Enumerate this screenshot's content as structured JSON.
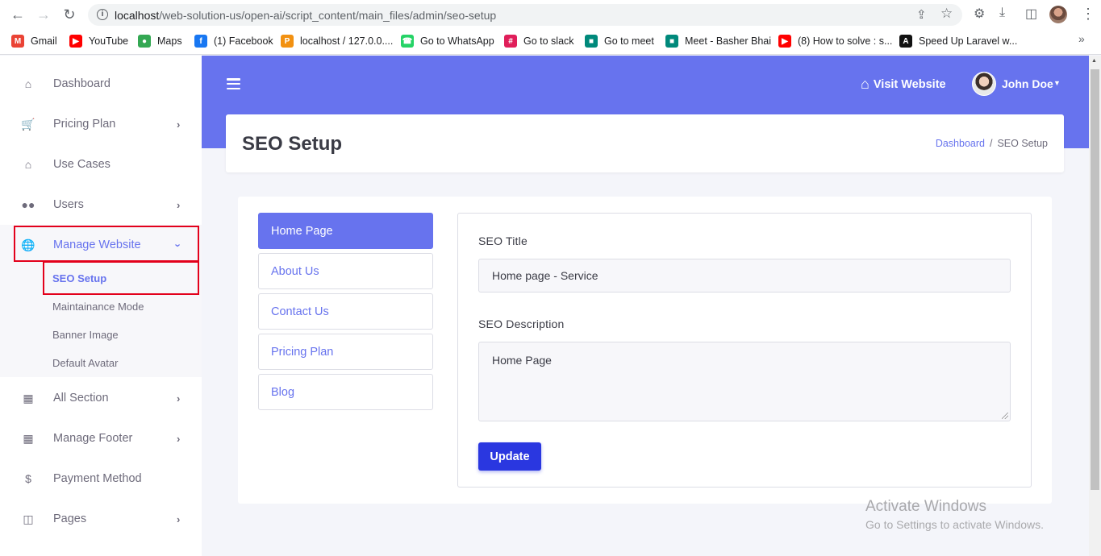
{
  "browser": {
    "url_host": "localhost",
    "url_path": "/web-solution-us/open-ai/script_content/main_files/admin/seo-setup",
    "bookmarks": [
      {
        "label": "Gmail",
        "icon": "gmail-icon",
        "color": "#ea4335"
      },
      {
        "label": "YouTube",
        "icon": "youtube-icon",
        "color": "#ff0000"
      },
      {
        "label": "Maps",
        "icon": "maps-icon",
        "color": "#34a853"
      },
      {
        "label": "(1) Facebook",
        "icon": "facebook-icon",
        "color": "#1877f2"
      },
      {
        "label": "localhost / 127.0.0....",
        "icon": "phpmyadmin-icon",
        "color": "#f29111"
      },
      {
        "label": "Go to WhatsApp",
        "icon": "whatsapp-icon",
        "color": "#25d366"
      },
      {
        "label": "Go to slack",
        "icon": "slack-icon",
        "color": "#e01e5a"
      },
      {
        "label": "Go to meet",
        "icon": "meet-icon",
        "color": "#00897b"
      },
      {
        "label": "Meet - Basher Bhai",
        "icon": "meet-icon",
        "color": "#00897b"
      },
      {
        "label": "(8) How to solve : s...",
        "icon": "youtube-icon",
        "color": "#ff0000"
      },
      {
        "label": "Speed Up Laravel w...",
        "icon": "laravel-icon",
        "color": "#111111"
      }
    ]
  },
  "sidebar": {
    "items": [
      {
        "label": "Dashboard",
        "icon": "home-icon",
        "has_children": false
      },
      {
        "label": "Pricing Plan",
        "icon": "cart-icon",
        "has_children": true
      },
      {
        "label": "Use Cases",
        "icon": "home-icon",
        "has_children": false
      },
      {
        "label": "Users",
        "icon": "users-icon",
        "has_children": true
      },
      {
        "label": "Manage Website",
        "icon": "globe-icon",
        "has_children": true,
        "expanded": true
      },
      {
        "label": "All Section",
        "icon": "grid-icon",
        "has_children": true
      },
      {
        "label": "Manage Footer",
        "icon": "grid-icon",
        "has_children": true
      },
      {
        "label": "Payment Method",
        "icon": "dollar-icon",
        "has_children": false
      },
      {
        "label": "Pages",
        "icon": "columns-icon",
        "has_children": true
      }
    ],
    "submenu": [
      "SEO Setup",
      "Maintainance Mode",
      "Banner Image",
      "Default Avatar"
    ],
    "active_sub": "SEO Setup"
  },
  "header": {
    "visit_label": "Visit Website",
    "user_name": "John Doe"
  },
  "page": {
    "title": "SEO Setup",
    "breadcrumb": {
      "link": "Dashboard",
      "current": "SEO Setup"
    }
  },
  "tabs": {
    "items": [
      "Home Page",
      "About Us",
      "Contact Us",
      "Pricing Plan",
      "Blog"
    ],
    "active": "Home Page"
  },
  "form": {
    "title_label": "SEO Title",
    "title_value": "Home page - Service",
    "description_label": "SEO Description",
    "description_value": "Home Page",
    "submit_label": "Update"
  },
  "watermark": {
    "line1": "Activate Windows",
    "line2": "Go to Settings to activate Windows."
  },
  "colors": {
    "accent": "#6773ee",
    "button": "#2a37e0",
    "highlight": "#e3001b"
  }
}
